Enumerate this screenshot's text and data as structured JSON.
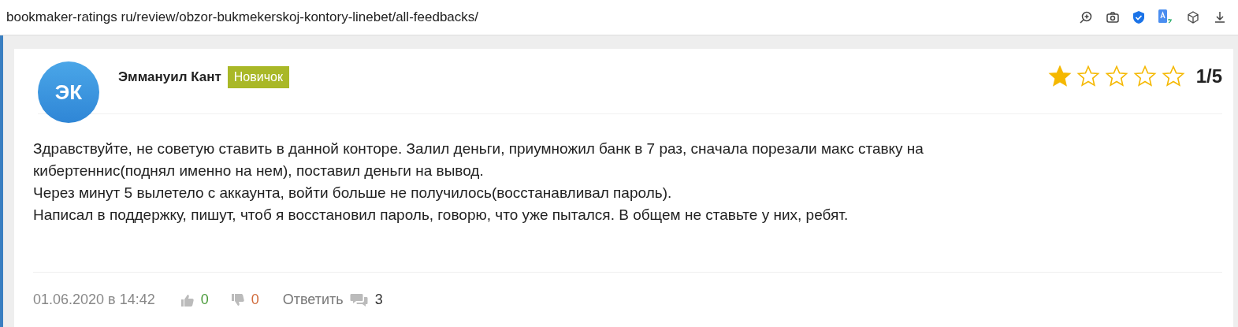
{
  "address_bar": {
    "url": "bookmaker-ratings ru/review/obzor-bukmekerskoj-kontory-linebet/all-feedbacks/"
  },
  "review": {
    "avatar_initials": "ЭК",
    "author": "Эммануил Кант",
    "badge": "Новичок",
    "stars": 1,
    "rating": "1/5",
    "paragraphs": [
      "Здравствуйте, не советую ставить в данной конторе. Залил деньги, приумножил банк в 7 раз, сначала порезали макс ставку на кибертеннис(поднял именно на нем), поставил деньги на вывод.",
      "Через минут 5 вылетело с аккаунта, войти больше не получилось(восстанавливал пароль).",
      "Написал в поддержку, пишут, чтоб я восстановил пароль, говорю, что уже пытался. В общем не ставьте у них, ребят."
    ],
    "date": "01.06.2020 в 14:42",
    "likes": "0",
    "dislikes": "0",
    "reply": "Ответить",
    "comments": "3"
  }
}
